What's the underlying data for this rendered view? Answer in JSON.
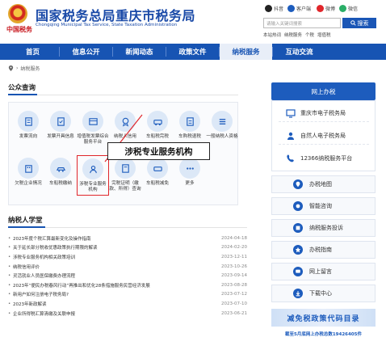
{
  "header": {
    "slogan": "中国税务",
    "title": "国家税务总局重庆市税务局",
    "subtitle": "Chongqing Municipal Tax Service, State Taxation Administration",
    "social": [
      {
        "label": "抖音",
        "icon": "douyin-icon",
        "color": "#222222"
      },
      {
        "label": "客户端",
        "icon": "mobile-client-icon",
        "color": "#1d5cbd"
      },
      {
        "label": "微博",
        "icon": "weibo-icon",
        "color": "#e0262b"
      },
      {
        "label": "微信",
        "icon": "wechat-icon",
        "color": "#2aae67"
      }
    ],
    "search_placeholder": "请输入关键词搜索",
    "search_label": "搜索",
    "hotwords": [
      "本站热词",
      "纳税服务",
      "个税",
      "增值税"
    ]
  },
  "nav": {
    "items": [
      "首页",
      "信息公开",
      "新闻动态",
      "政策文件",
      "纳税服务",
      "互动交流"
    ],
    "active": "纳税服务"
  },
  "breadcrumb": "纳税服务",
  "public_query": {
    "title": "公众查询",
    "items": [
      {
        "label": "发票流向",
        "icon": "invoice-flow-icon"
      },
      {
        "label": "发票开具信息",
        "icon": "invoice-issue-icon"
      },
      {
        "label": "增值税发票综合服务平台",
        "icon": "vat-platform-icon"
      },
      {
        "label": "纳税人信用",
        "icon": "taxpayer-credit-icon"
      },
      {
        "label": "车船税完税",
        "icon": "vessel-tax-icon"
      },
      {
        "label": "车购税退税",
        "icon": "purchase-tax-icon"
      },
      {
        "label": "一般纳税人资格",
        "icon": "general-taxpayer-icon"
      },
      {
        "label": "欠税企业情况",
        "icon": "arrears-enterprise-icon"
      },
      {
        "label": "车船税缴纳",
        "icon": "vessel-payment-icon"
      },
      {
        "label": "涉税专业服务机构",
        "icon": "professional-service-icon"
      },
      {
        "label": "完税证明（缴款、所得）查询",
        "icon": "tax-certificate-icon"
      },
      {
        "label": "车船税减免",
        "icon": "vessel-relief-icon"
      },
      {
        "label": "更多",
        "icon": "more-icon"
      }
    ],
    "highlight": "涉税专业服务机构"
  },
  "callout": "涉税专业服务机构",
  "classroom": {
    "title": "纳税人学堂",
    "items": [
      {
        "title": "2023年度个税汇算最新变化及操作指南",
        "date": "2024-04-18"
      },
      {
        "title": "关于延长部分税收优惠政策执行期限的解读",
        "date": "2024-02-20"
      },
      {
        "title": "涉税专业服务机构相关政策培训",
        "date": "2023-12-11"
      },
      {
        "title": "纳税信用评价",
        "date": "2023-10-26"
      },
      {
        "title": "灵活就业人员医保缴费办理流程",
        "date": "2023-09-14"
      },
      {
        "title": "2023年“便民办税春风行动”再推出和优化28条措施服务民营经济发展",
        "date": "2023-08-28"
      },
      {
        "title": "新用户如何注册电子税务局?",
        "date": "2023-07-12"
      },
      {
        "title": "2023年新政解读",
        "date": "2023-07-10"
      },
      {
        "title": "企业所得税汇算清缴及关联申报",
        "date": "2023-06-21"
      }
    ]
  },
  "right": {
    "head": "网上办税",
    "links": [
      {
        "label": "重庆市电子税务局",
        "icon": "e-tax-bureau-icon"
      },
      {
        "label": "自然人电子税务局",
        "icon": "natural-person-icon"
      },
      {
        "label": "12366纳税服务平台",
        "icon": "service-platform-icon"
      }
    ],
    "services": [
      {
        "label": "办税地图",
        "icon": "map-pin-icon"
      },
      {
        "label": "智能咨询",
        "icon": "smart-consult-icon"
      },
      {
        "label": "纳税服务投诉",
        "icon": "complaint-icon"
      },
      {
        "label": "办税指南",
        "icon": "guide-icon"
      },
      {
        "label": "网上留言",
        "icon": "message-icon"
      },
      {
        "label": "下载中心",
        "icon": "download-icon"
      }
    ],
    "banner": "减免税政策代码目录",
    "banner_note": "截至5月底网上办税总数19426405件",
    "accent": "#1d5cbd"
  }
}
